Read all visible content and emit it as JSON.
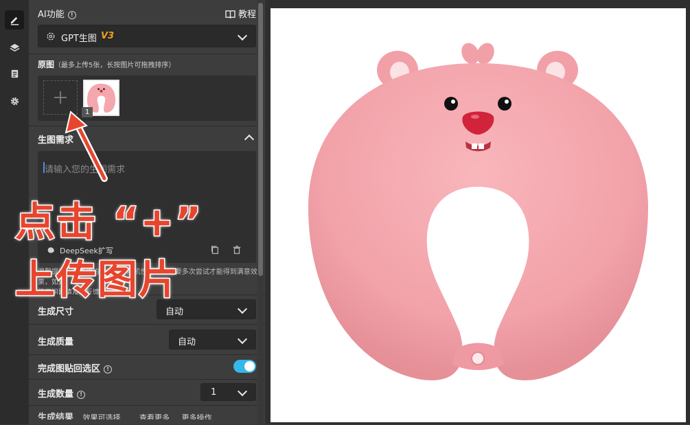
{
  "sidebar_tools": [
    "edit-icon",
    "layers-icon",
    "document-icon",
    "gear-icon"
  ],
  "panel": {
    "ai_title": "AI功能",
    "tutorial_label": "教程",
    "model_name": "GPT生图",
    "model_version": "V3",
    "source_title": "原图",
    "source_hint": "（最多上传5张，长按图片可拖拽排序）",
    "thumb_index": "1",
    "prompt_title": "生图需求",
    "prompt_placeholder": "请输入您的生图需求",
    "deepseek_label": "DeepSeek扩写",
    "note_line1": "温馨提示：AI生成的图片具有随机性，偶尔需要多次尝试才能得到满意效果，如遇",
    "note_line2": "使用问题请及时反馈客服。",
    "size_label": "生成尺寸",
    "size_value": "自动",
    "quality_label": "生成质量",
    "quality_value": "自动",
    "paste_label": "完成图贴回选区",
    "paste_on": true,
    "count_label": "生成数量",
    "count_value": "1",
    "result_label": "生成结果",
    "result_opt1": "效果可选择",
    "result_opt2": "查看更多",
    "result_opt3": "更多操作"
  },
  "overlay": {
    "line1": "点击 “+”",
    "line2": "上传图片"
  },
  "colors": {
    "accent": "#f0a020",
    "toggle": "#35b8e8",
    "annotation": "#e8452e",
    "pillow": "#f4a7ad"
  }
}
